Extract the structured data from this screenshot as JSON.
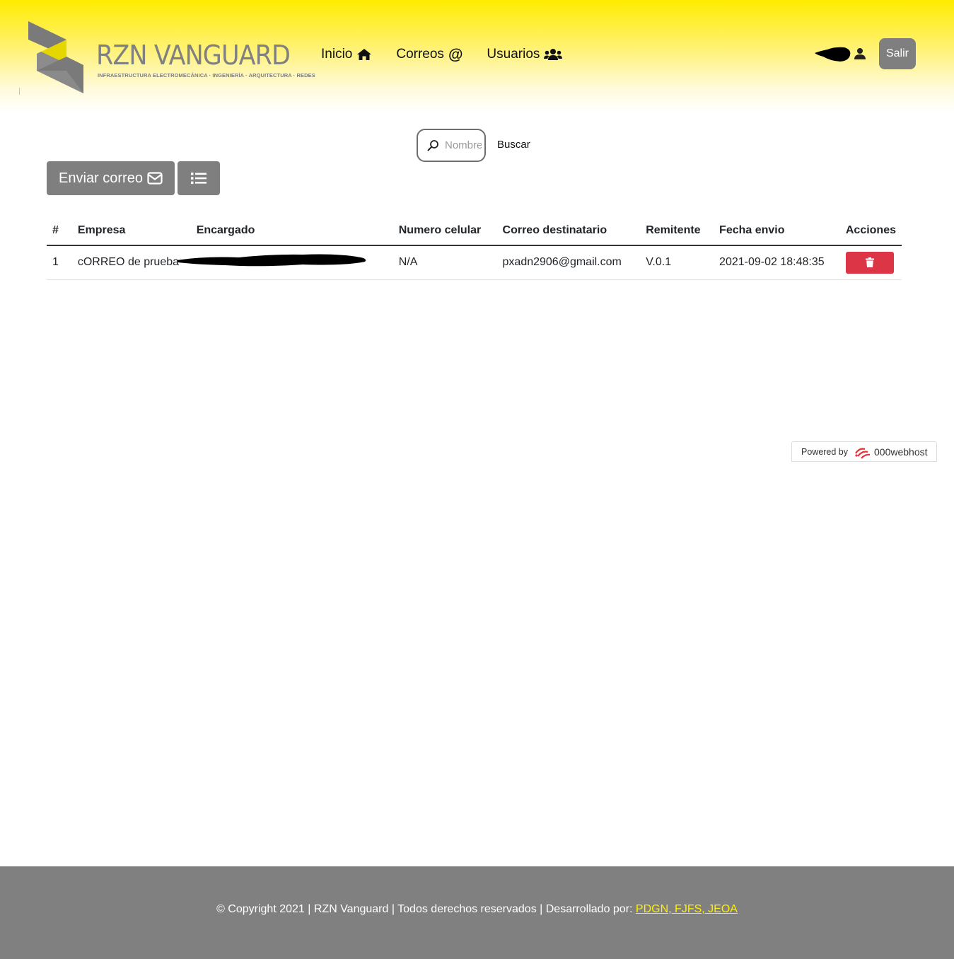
{
  "header": {
    "brand_name": "RZN VANGUARD",
    "brand_tagline": "INFRAESTRUCTURA ELECTROMECÁNICA · INGENIERÍA · ARQUITECTURA · REDES",
    "nav": [
      {
        "label": "Inicio",
        "icon": "home-icon"
      },
      {
        "label": "Correos",
        "icon": "at-icon"
      },
      {
        "label": "Usuarios",
        "icon": "users-icon"
      }
    ],
    "logout_label": "Salir",
    "accent_color": "#ffec00"
  },
  "search": {
    "placeholder": "Nombre",
    "button_label": "Buscar"
  },
  "actions": {
    "send_label": "Enviar correo",
    "send_icon": "envelope-icon",
    "list_icon": "list-icon"
  },
  "table": {
    "headers": [
      "#",
      "Empresa",
      "Encargado",
      "Numero celular",
      "Correo destinatario",
      "Remitente",
      "Fecha envio",
      "Acciones"
    ],
    "rows": [
      {
        "num": "1",
        "empresa": "cORREO de prueba",
        "encargado": "",
        "celular": "N/A",
        "correo": "pxadn2906@gmail.com",
        "remitente": "V.0.1",
        "fecha": "2021-09-02 18:48:35",
        "action_icon": "trash-icon"
      }
    ],
    "delete_color": "#dc3545"
  },
  "powered": {
    "label": "Powered by",
    "brand": "000webhost"
  },
  "footer": {
    "text": "© Copyright 2021 | RZN Vanguard | Todos derechos reservados | Desarrollado por: ",
    "link": "PDGN, FJFS, JEOA",
    "bg_color": "#808080"
  }
}
